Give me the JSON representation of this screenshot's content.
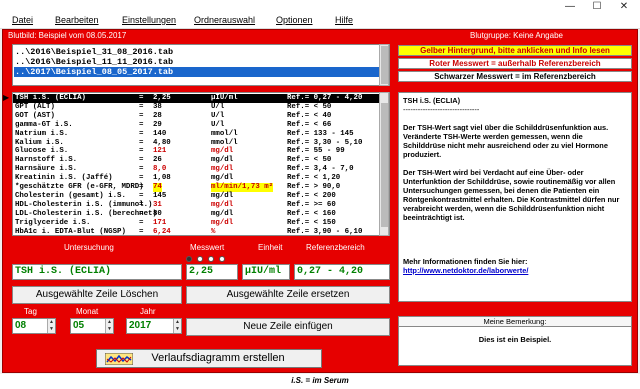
{
  "menu": [
    "Datei",
    "Bearbeiten",
    "Einstellungen",
    "Ordnerauswahl",
    "Optionen",
    "Hilfe"
  ],
  "window_controls": {
    "minimize": "—",
    "maximize": "☐",
    "close": "✕"
  },
  "status": {
    "left": "Blutbild: Beispiel vom 08.05.2017",
    "right": "Blutgruppe: Keine Angabe"
  },
  "files": [
    "..\\2016\\Beispiel_31_08_2016.tab",
    "..\\2016\\Beispiel_11_11_2016.tab",
    "..\\2017\\Beispiel_08_05_2017.tab"
  ],
  "rows": [
    {
      "name": "TSH i.S. (ECLIA)",
      "eq": "=",
      "value": "2,25",
      "unit": "µIU/ml",
      "ref": "Ref.= 0,27 - 4,20",
      "state": "selected"
    },
    {
      "name": "GPT (ALT)",
      "eq": "=",
      "value": "38",
      "unit": "U/l",
      "ref": "Ref.= < 50",
      "state": "normal"
    },
    {
      "name": "GOT (AST)",
      "eq": "=",
      "value": "28",
      "unit": "U/l",
      "ref": "Ref.= < 40",
      "state": "normal"
    },
    {
      "name": "gamma-GT i.S.",
      "eq": "=",
      "value": "29",
      "unit": "U/l",
      "ref": "Ref.= < 66",
      "state": "normal"
    },
    {
      "name": "Natrium i.S.",
      "eq": "=",
      "value": "140",
      "unit": "mmol/l",
      "ref": "Ref.= 133 - 145",
      "state": "normal"
    },
    {
      "name": "Kalium i.S.",
      "eq": "=",
      "value": "4,80",
      "unit": "mmol/l",
      "ref": "Ref.= 3,30 - 5,10",
      "state": "normal"
    },
    {
      "name": "Glucose i.S.",
      "eq": "=",
      "value": "121",
      "unit": "mg/dl",
      "ref": "Ref.= 55 - 99",
      "state": "high"
    },
    {
      "name": "Harnstoff i.S.",
      "eq": "=",
      "value": "26",
      "unit": "mg/dl",
      "ref": "Ref.= < 50",
      "state": "normal"
    },
    {
      "name": "Harnsäure i.S.",
      "eq": "=",
      "value": "8,0",
      "unit": "mg/dl",
      "ref": "Ref.= 3,4 - 7,0",
      "state": "high"
    },
    {
      "name": "Kreatinin i.S. (Jaffé)",
      "eq": "=",
      "value": "1,08",
      "unit": "mg/dl",
      "ref": "Ref.= < 1,20",
      "state": "normal"
    },
    {
      "name": "*geschätzte GFR (e-GFR, MDRD)",
      "eq": "=",
      "value": "74",
      "unit": "ml/min/1,73 m²",
      "ref": "Ref.= > 90,0",
      "state": "info"
    },
    {
      "name": "Cholesterin (gesamt) i.S.",
      "eq": "=",
      "value": "145",
      "unit": "mg/dl",
      "ref": "Ref.= < 200",
      "state": "normal"
    },
    {
      "name": "HDL-Cholesterin i.S. (immunol.)",
      "eq": "=",
      "value": "31",
      "unit": "mg/dl",
      "ref": "Ref.= >= 60",
      "state": "high"
    },
    {
      "name": "LDL-Cholesterin i.S. (berechnet)",
      "eq": "=",
      "value": "80",
      "unit": "mg/dl",
      "ref": "Ref.= < 160",
      "state": "normal"
    },
    {
      "name": "Triglyceride i.S.",
      "eq": "=",
      "value": "171",
      "unit": "mg/dl",
      "ref": "Ref.= < 150",
      "state": "high"
    },
    {
      "name": "HbA1c i. EDTA-Blut (NGSP)",
      "eq": "=",
      "value": "6,24",
      "unit": "%",
      "ref": "Ref.= 3,90 - 6,10",
      "state": "high"
    }
  ],
  "edit": {
    "headers": {
      "exam": "Untersuchung",
      "value": "Messwert",
      "unit": "Einheit",
      "ref": "Referenzbereich"
    },
    "exam": "TSH i.S. (ECLIA)",
    "value": "2,25",
    "unit": "µIU/ml",
    "ref": "0,27 - 4,20",
    "delete_label": "Ausgewählte Zeile Löschen",
    "replace_label": "Ausgewählte Zeile ersetzen",
    "insert_label": "Neue Zeile einfügen",
    "date_labels": {
      "day": "Tag",
      "month": "Monat",
      "year": "Jahr"
    },
    "day": "08",
    "month": "05",
    "year": "2017"
  },
  "legend": {
    "yellow": "Gelber Hintergrund, bitte anklicken und Info lesen",
    "red": "Roter Messwert = außerhalb Referenzbereich",
    "black": "Schwarzer Messwert  =  im Referenzbereich"
  },
  "info": {
    "title": "TSH i.S. (ECLIA)",
    "rule": "-------------------------------",
    "p1": "Der TSH-Wert sagt viel über die Schilddrüsenfunktion aus. Veränderte TSH-Werte werden gemessen, wenn die Schilddrüse nicht mehr ausreichend oder zu viel Hormone produziert.",
    "p2": "Der TSH-Wert wird bei Verdacht auf eine Über- oder Unterfunktion der Schilddrüse, sowie  routinemäßig vor allen Untersuchungen gemessen, bei denen die Patienten ein Röntgenkontrastmittel erhalten. Die Kontrastmittel dürfen nur verabreicht werden, wenn die Schilddrüsenfunktion nicht beeinträchtigt ist.",
    "more": "Mehr Informationen finden Sie hier:",
    "link": "http://www.netdoktor.de/laborwerte/"
  },
  "note": {
    "header": "Meine Bemerkung:",
    "text": "Dies ist ein Beispiel."
  },
  "chart_button": "Verlaufsdiagramm erstellen",
  "footer": "i.S. = im Serum",
  "colors": {
    "frame": "#e60000",
    "highlight": "#ffff00",
    "selection": "#1a66cc",
    "value_green": "#008000"
  }
}
